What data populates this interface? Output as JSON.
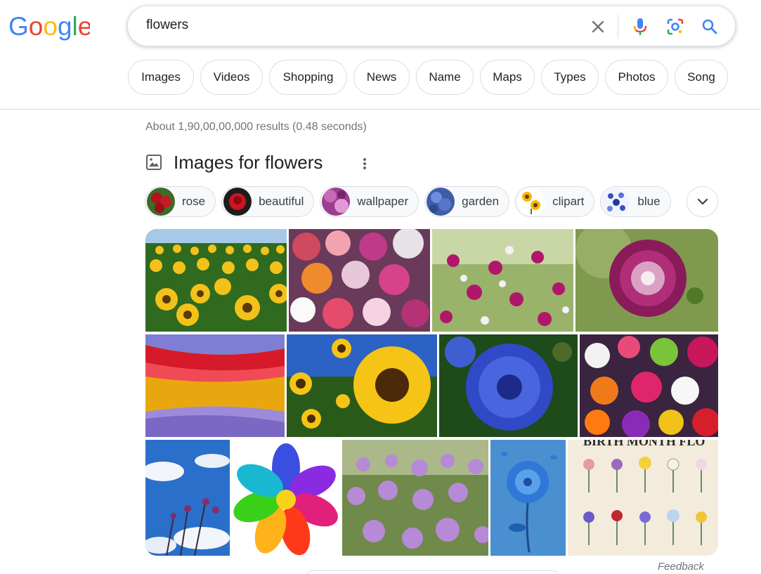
{
  "logo": {
    "letters": [
      "G",
      "o",
      "o",
      "g",
      "l",
      "e"
    ],
    "colors": [
      "#4285F4",
      "#EA4335",
      "#FBBC05",
      "#4285F4",
      "#34A853",
      "#EA4335"
    ]
  },
  "search": {
    "query": "flowers",
    "icons": [
      "clear-icon",
      "microphone-icon",
      "camera-lens-icon",
      "search-icon"
    ]
  },
  "filters": [
    "Images",
    "Videos",
    "Shopping",
    "News",
    "Name",
    "Maps",
    "Types",
    "Photos",
    "Song"
  ],
  "result_stats": "About 1,90,00,00,000 results (0.48 seconds)",
  "images_section": {
    "title": "Images for flowers",
    "refinements": [
      "rose",
      "beautiful",
      "wallpaper",
      "garden",
      "clipart",
      "blue"
    ]
  },
  "grid_tiles": [
    {
      "name": "sunflower-field"
    },
    {
      "name": "mixed-bouquet"
    },
    {
      "name": "cosmos-meadow"
    },
    {
      "name": "purple-dahlia"
    },
    {
      "name": "flower-field-rows"
    },
    {
      "name": "sunflowers-sky"
    },
    {
      "name": "blue-cornflower"
    },
    {
      "name": "colorful-bouquet"
    },
    {
      "name": "sky-wildflowers"
    },
    {
      "name": "rainbow-flower"
    },
    {
      "name": "chive-blossoms"
    },
    {
      "name": "blue-flower-on-blue"
    },
    {
      "name": "birth-month-flowers-chart"
    }
  ],
  "birth_month_chart": {
    "heading": "BIRTH MONTH FLO"
  },
  "feedback": "Feedback",
  "colors": {
    "link_gray": "#70757a",
    "border": "#dadce0",
    "blue": "#4285F4"
  }
}
